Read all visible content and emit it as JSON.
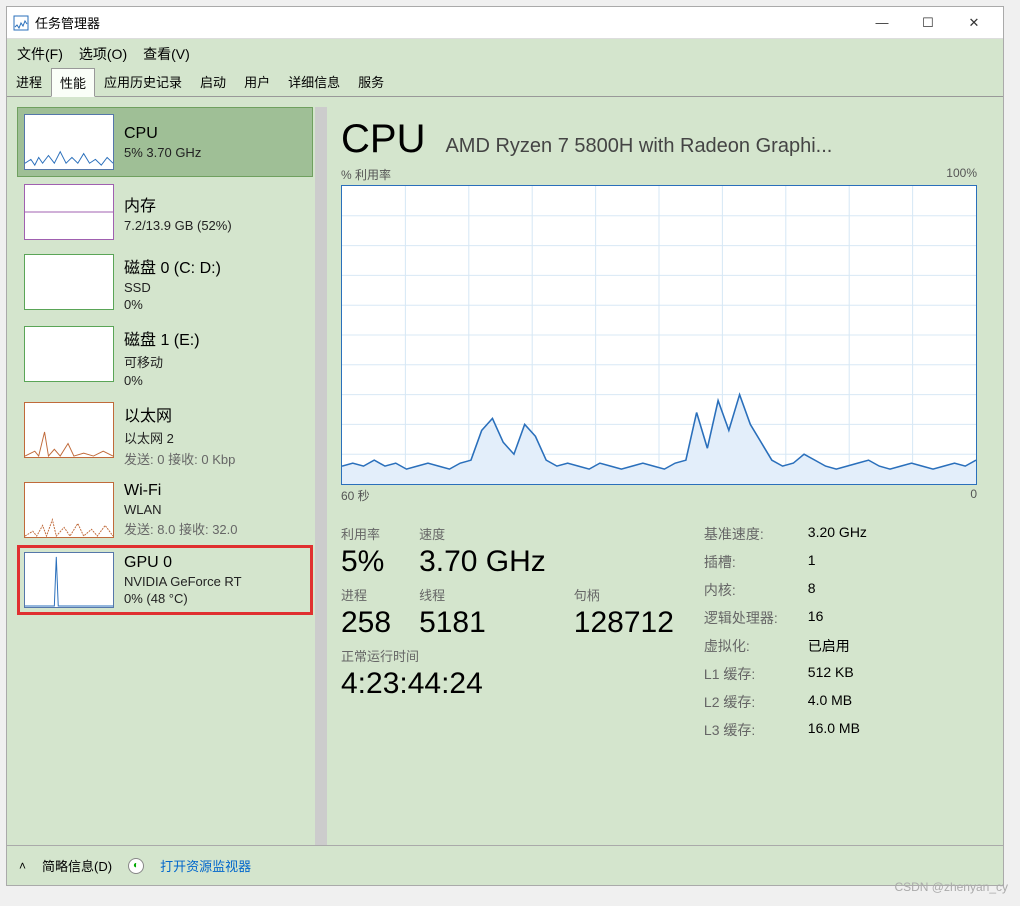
{
  "window": {
    "title": "任务管理器"
  },
  "menu": {
    "file": "文件(F)",
    "options": "选项(O)",
    "view": "查看(V)"
  },
  "tabs": {
    "processes": "进程",
    "performance": "性能",
    "apphistory": "应用历史记录",
    "startup": "启动",
    "users": "用户",
    "details": "详细信息",
    "services": "服务"
  },
  "sidebar": [
    {
      "title": "CPU",
      "sub1": "5%  3.70 GHz"
    },
    {
      "title": "内存",
      "sub1": "7.2/13.9 GB (52%)"
    },
    {
      "title": "磁盘 0 (C: D:)",
      "sub1": "SSD",
      "sub2": "0%"
    },
    {
      "title": "磁盘 1 (E:)",
      "sub1": "可移动",
      "sub2": "0%"
    },
    {
      "title": "以太网",
      "sub1": "以太网 2",
      "send_label": "发送:",
      "send_val": "0",
      "recv_label": "接收:",
      "recv_val": "0 Kbp"
    },
    {
      "title": "Wi-Fi",
      "sub1": "WLAN",
      "send_label": "发送:",
      "send_val": "8.0",
      "recv_label": "接收:",
      "recv_val": "32.0"
    },
    {
      "title": "GPU 0",
      "sub1": "NVIDIA GeForce RT",
      "sub2": "0%  (48 °C)"
    }
  ],
  "main": {
    "title": "CPU",
    "subtitle": "AMD Ryzen 7 5800H with Radeon Graphi...",
    "y_label": "% 利用率",
    "y_max": "100%",
    "x_left": "60 秒",
    "x_right": "0"
  },
  "stats": {
    "util_label": "利用率",
    "util": "5%",
    "speed_label": "速度",
    "speed": "3.70 GHz",
    "proc_label": "进程",
    "proc": "258",
    "thread_label": "线程",
    "thread": "5181",
    "handle_label": "句柄",
    "handle": "128712",
    "uptime_label": "正常运行时间",
    "uptime": "4:23:44:24"
  },
  "specs": {
    "base_label": "基准速度:",
    "base": "3.20 GHz",
    "sockets_label": "插槽:",
    "sockets": "1",
    "cores_label": "内核:",
    "cores": "8",
    "logical_label": "逻辑处理器:",
    "logical": "16",
    "virt_label": "虚拟化:",
    "virt": "已启用",
    "l1_label": "L1 缓存:",
    "l1": "512 KB",
    "l2_label": "L2 缓存:",
    "l2": "4.0 MB",
    "l3_label": "L3 缓存:",
    "l3": "16.0 MB"
  },
  "footer": {
    "brief": "简略信息(D)",
    "resmon": "打开资源监视器"
  },
  "chart_data": {
    "type": "area",
    "title": "CPU % 利用率",
    "xlabel": "秒",
    "ylabel": "% 利用率",
    "x_range": [
      60,
      0
    ],
    "ylim": [
      0,
      100
    ],
    "values": [
      6,
      7,
      6,
      8,
      6,
      7,
      5,
      6,
      7,
      6,
      5,
      7,
      8,
      18,
      22,
      14,
      10,
      20,
      16,
      8,
      6,
      7,
      6,
      5,
      7,
      6,
      5,
      6,
      7,
      6,
      5,
      7,
      8,
      24,
      12,
      28,
      18,
      30,
      20,
      14,
      8,
      6,
      7,
      10,
      8,
      6,
      5,
      6,
      7,
      8,
      6,
      5,
      6,
      7,
      6,
      5,
      6,
      7,
      6,
      8
    ]
  },
  "watermark": "CSDN @zhenyan_cy"
}
